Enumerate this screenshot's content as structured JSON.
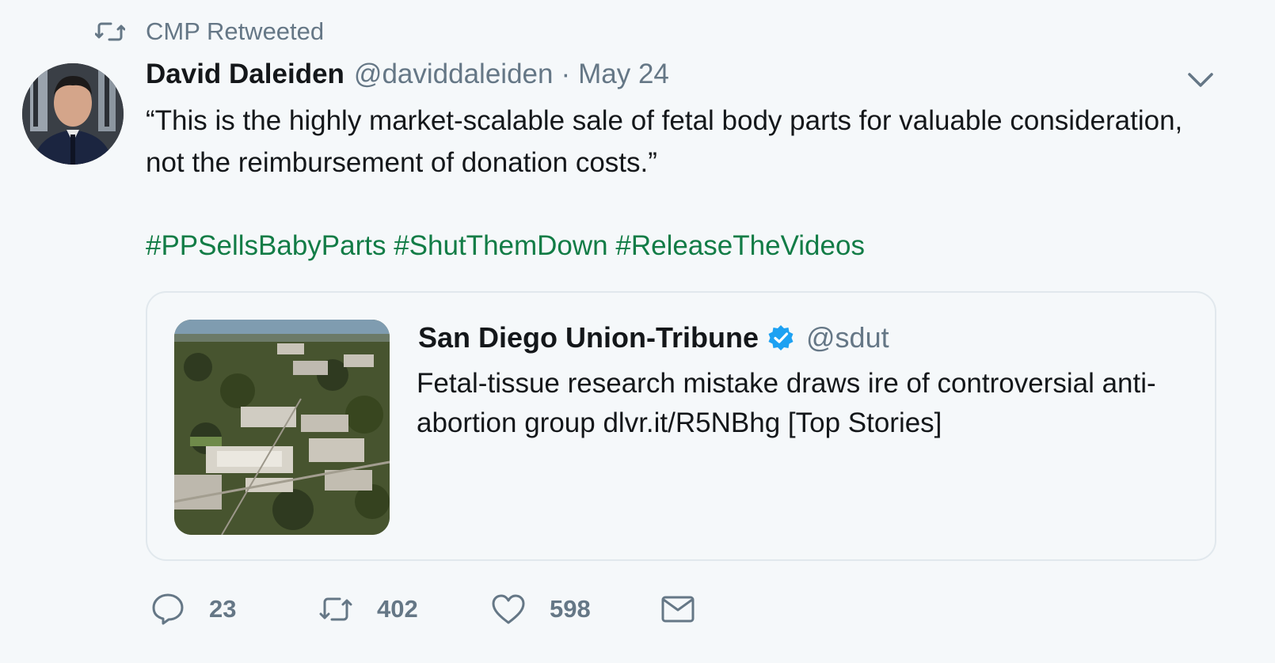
{
  "retweet_context": {
    "text": "CMP Retweeted",
    "icon": "retweet-icon"
  },
  "author": {
    "name": "David Daleiden",
    "handle": "@daviddaleiden",
    "separator": "·",
    "date": "May 24"
  },
  "tweet": {
    "text": "“This is the highly market-scalable sale of fetal body parts for valuable consideration, not the reimbursement of donation costs.”",
    "hashtags": [
      "#PPSellsBabyParts",
      "#ShutThemDown",
      "#ReleaseTheVideos"
    ]
  },
  "quoted_tweet": {
    "name": "San Diego Union-Tribune",
    "verified": true,
    "handle": "@sdut",
    "text": "Fetal-tissue research mistake draws ire of controversial anti-abortion group dlvr.it/R5NBhg [Top Stories]"
  },
  "actions": {
    "reply_count": "23",
    "retweet_count": "402",
    "like_count": "598"
  },
  "colors": {
    "background": "#f5f8fa",
    "secondary_text": "#657786",
    "hashtag": "#127c46",
    "verified_badge": "#1da1f2",
    "card_border": "#e1e8ed"
  }
}
